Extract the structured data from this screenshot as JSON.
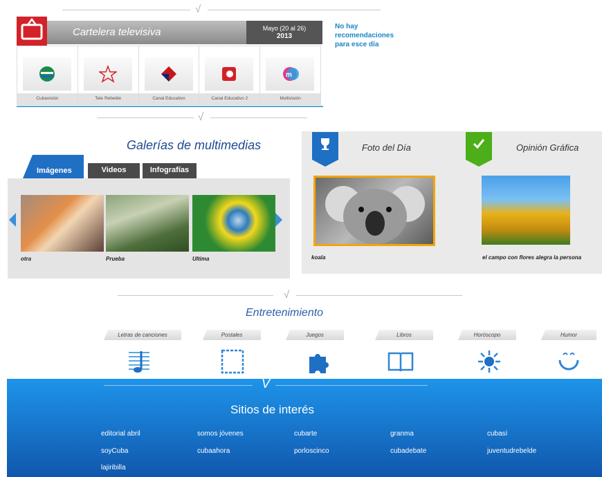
{
  "tv": {
    "title": "Cartelera televisiva",
    "date_range": "Mayo (20 al 26)",
    "year": "2013",
    "no_recs_line1": "No hay",
    "no_recs_line2": "recomendaciones",
    "no_recs_line3": "para esce día",
    "channels": [
      {
        "name": "Cubavisión",
        "icon": "cubavision-logo-icon"
      },
      {
        "name": "Tele Rebelde",
        "icon": "star-logo-icon"
      },
      {
        "name": "Canal Educativo",
        "icon": "diamond-logo-icon"
      },
      {
        "name": "Canal Educativo 2",
        "icon": "red-square-logo-icon"
      },
      {
        "name": "Multivisión",
        "icon": "mv-logo-icon"
      }
    ],
    "accent_color": "#d3222a"
  },
  "gallery": {
    "title": "Galerías de multimedias",
    "tabs": [
      "Imágenes",
      "Videos",
      "Infografías"
    ],
    "items": [
      {
        "caption": "otra"
      },
      {
        "caption": "Prueba"
      },
      {
        "caption": "Ultima"
      }
    ]
  },
  "foto": {
    "title": "Foto del Día",
    "caption": "koala",
    "badge_icon": "trophy-icon",
    "badge_color": "#1f6fc4"
  },
  "opinion": {
    "title": "Opinión Gráfica",
    "caption": "el campo con flores alegra la persona",
    "badge_icon": "check-icon",
    "badge_color": "#4caf1a"
  },
  "entretenimiento": {
    "title": "Entretenimiento",
    "items": [
      {
        "label": "Letras de canciones",
        "icon": "music-note-icon"
      },
      {
        "label": "Postales",
        "icon": "postcard-icon"
      },
      {
        "label": "Juegos",
        "icon": "puzzle-icon"
      },
      {
        "label": "Libros",
        "icon": "book-icon"
      },
      {
        "label": "Horóscopo",
        "icon": "sun-icon"
      },
      {
        "label": "Humor",
        "icon": "smiley-icon"
      }
    ]
  },
  "sitios": {
    "title": "Sitios de interés",
    "links": [
      "editorial abril",
      "somos jóvenes",
      "cubarte",
      "granma",
      "cubasí",
      "soyCuba",
      "cubaahora",
      "porloscinco",
      "cubadebate",
      "juventudrebelde",
      "lajiribilla"
    ]
  }
}
